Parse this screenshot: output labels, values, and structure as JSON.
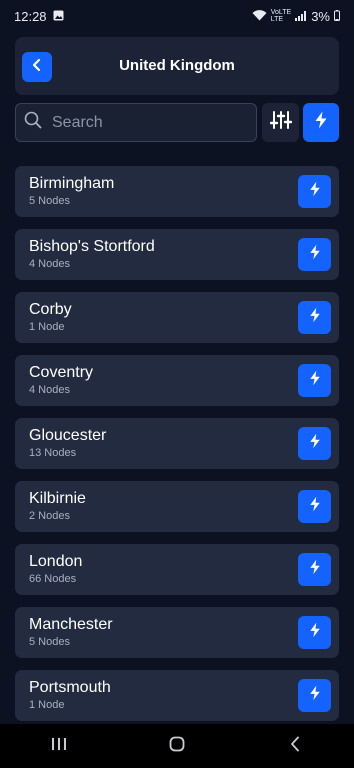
{
  "status_bar": {
    "time": "12:28",
    "network_top": "VoLTE",
    "network_bottom": "LTE",
    "battery": "3%"
  },
  "header": {
    "title": "United Kingdom"
  },
  "search": {
    "placeholder": "Search"
  },
  "cities": [
    {
      "name": "Birmingham",
      "nodes": "5 Nodes"
    },
    {
      "name": "Bishop's Stortford",
      "nodes": "4 Nodes"
    },
    {
      "name": "Corby",
      "nodes": "1 Node"
    },
    {
      "name": "Coventry",
      "nodes": "4 Nodes"
    },
    {
      "name": "Gloucester",
      "nodes": "13 Nodes"
    },
    {
      "name": "Kilbirnie",
      "nodes": "2 Nodes"
    },
    {
      "name": "London",
      "nodes": "66 Nodes"
    },
    {
      "name": "Manchester",
      "nodes": "5 Nodes"
    },
    {
      "name": "Portsmouth",
      "nodes": "1 Node"
    }
  ],
  "colors": {
    "accent": "#1463ff",
    "background": "#0c1222",
    "card": "#232b40"
  }
}
